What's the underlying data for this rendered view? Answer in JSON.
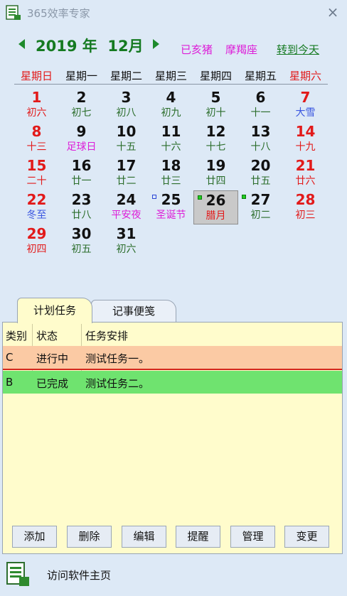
{
  "window": {
    "title": "365效率专家",
    "close_glyph": "×",
    "icon": "notepad-icon"
  },
  "nav": {
    "month_label": "2019 年  12月",
    "ganzhi": "已亥猪",
    "zodiac": "摩羯座",
    "today_link": "转到今天"
  },
  "weekdays": [
    "星期日",
    "星期一",
    "星期二",
    "星期三",
    "星期四",
    "星期五",
    "星期六"
  ],
  "calendar": {
    "selected_day": "26",
    "days": [
      {
        "d": "1",
        "l": "初六"
      },
      {
        "d": "2",
        "l": "初七"
      },
      {
        "d": "3",
        "l": "初八"
      },
      {
        "d": "4",
        "l": "初九"
      },
      {
        "d": "5",
        "l": "初十"
      },
      {
        "d": "6",
        "l": "十一"
      },
      {
        "d": "7",
        "l": "大雪"
      },
      {
        "d": "8",
        "l": "十三"
      },
      {
        "d": "9",
        "l": "足球日"
      },
      {
        "d": "10",
        "l": "十五"
      },
      {
        "d": "11",
        "l": "十六"
      },
      {
        "d": "12",
        "l": "十七"
      },
      {
        "d": "13",
        "l": "十八"
      },
      {
        "d": "14",
        "l": "十九"
      },
      {
        "d": "15",
        "l": "二十"
      },
      {
        "d": "16",
        "l": "廿一"
      },
      {
        "d": "17",
        "l": "廿二"
      },
      {
        "d": "18",
        "l": "廿三"
      },
      {
        "d": "19",
        "l": "廿四"
      },
      {
        "d": "20",
        "l": "廿五"
      },
      {
        "d": "21",
        "l": "廿六"
      },
      {
        "d": "22",
        "l": "冬至"
      },
      {
        "d": "23",
        "l": "廿八"
      },
      {
        "d": "24",
        "l": "平安夜"
      },
      {
        "d": "25",
        "l": "圣诞节"
      },
      {
        "d": "26",
        "l": "腊月"
      },
      {
        "d": "27",
        "l": "初二"
      },
      {
        "d": "28",
        "l": "初三"
      },
      {
        "d": "29",
        "l": "初四"
      },
      {
        "d": "30",
        "l": "初五"
      },
      {
        "d": "31",
        "l": "初六"
      }
    ]
  },
  "tabs": {
    "tasks": "计划任务",
    "notes": "记事便笺"
  },
  "table": {
    "headers": [
      "类别",
      "状态",
      "任务安排"
    ],
    "rows": [
      {
        "category": "C",
        "status": "进行中",
        "task": "测试任务一。"
      },
      {
        "category": "B",
        "status": "已完成",
        "task": "测试任务二。"
      }
    ]
  },
  "buttons": [
    "添加",
    "删除",
    "编辑",
    "提醒",
    "管理",
    "变更"
  ],
  "footer": {
    "link": "访问软件主页",
    "icon": "notepad-icon"
  },
  "colors": {
    "background": "#dde9f6",
    "accent_green": "#157a21",
    "weekend_red": "#e21a1a",
    "holiday_pink": "#dd1dd8",
    "solar_term_blue": "#3a56e0",
    "panel_yellow": "#fffccc",
    "row_in_progress": "#fbcaa4",
    "row_done": "#6fe36f"
  }
}
